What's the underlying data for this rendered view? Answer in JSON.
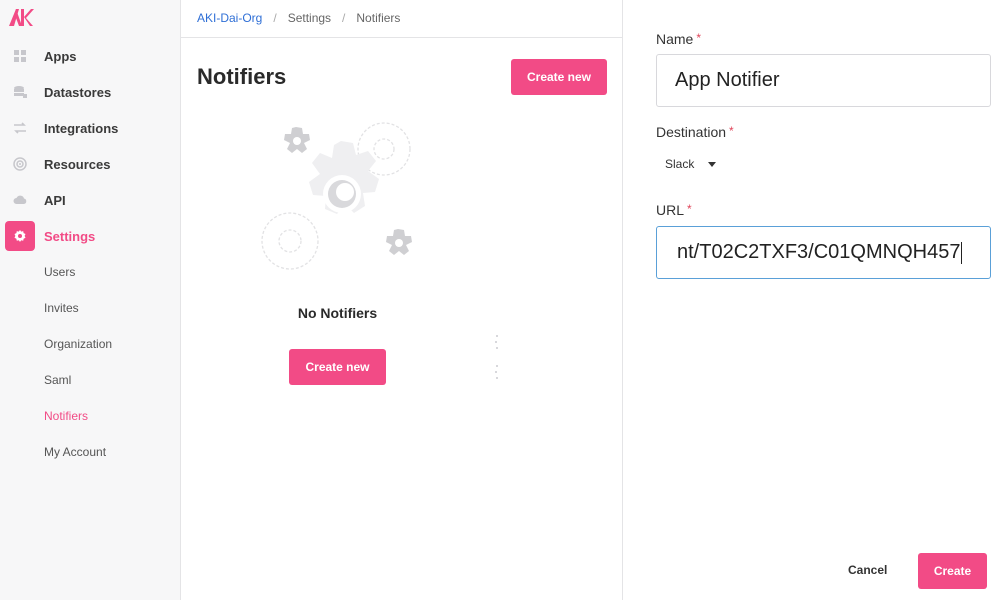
{
  "app": {
    "logo_text": "AK"
  },
  "sidebar": {
    "items": [
      {
        "label": "Apps",
        "icon": "apps-icon"
      },
      {
        "label": "Datastores",
        "icon": "datastore-icon"
      },
      {
        "label": "Integrations",
        "icon": "integrations-icon"
      },
      {
        "label": "Resources",
        "icon": "resources-icon"
      },
      {
        "label": "API",
        "icon": "cloud-icon"
      },
      {
        "label": "Settings",
        "icon": "gear-icon",
        "active": true
      }
    ],
    "sub_items": [
      {
        "label": "Users"
      },
      {
        "label": "Invites"
      },
      {
        "label": "Organization"
      },
      {
        "label": "Saml"
      },
      {
        "label": "Notifiers",
        "active": true
      },
      {
        "label": "My Account"
      }
    ]
  },
  "breadcrumb": {
    "org": "AKI-Dai-Org",
    "separator": "/",
    "settings": "Settings",
    "current": "Notifiers"
  },
  "main": {
    "title": "Notifiers",
    "create_label": "Create new",
    "empty_title": "No Notifiers",
    "empty_create_label": "Create new"
  },
  "form": {
    "name_label": "Name",
    "name_value": "App Notifier",
    "destination_label": "Destination",
    "destination_value": "Slack",
    "url_label": "URL",
    "url_value": "nt/T02C2TXF3/C01QMNQH457",
    "required_mark": "*",
    "cancel_label": "Cancel",
    "submit_label": "Create"
  },
  "colors": {
    "accent": "#f24b86",
    "link": "#2f6fd6",
    "focus": "#5aa0d8"
  }
}
